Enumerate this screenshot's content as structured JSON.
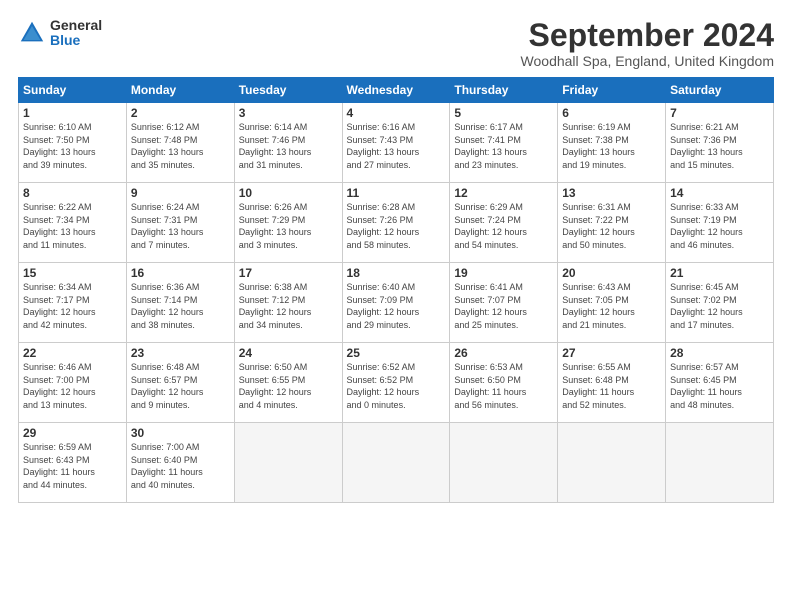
{
  "logo": {
    "general": "General",
    "blue": "Blue"
  },
  "title": "September 2024",
  "subtitle": "Woodhall Spa, England, United Kingdom",
  "headers": [
    "Sunday",
    "Monday",
    "Tuesday",
    "Wednesday",
    "Thursday",
    "Friday",
    "Saturday"
  ],
  "days": [
    {
      "num": "",
      "info": ""
    },
    {
      "num": "",
      "info": ""
    },
    {
      "num": "",
      "info": ""
    },
    {
      "num": "",
      "info": ""
    },
    {
      "num": "",
      "info": ""
    },
    {
      "num": "",
      "info": ""
    },
    {
      "num": "1",
      "info": "Sunrise: 6:10 AM\nSunset: 7:50 PM\nDaylight: 13 hours\nand 39 minutes."
    },
    {
      "num": "2",
      "info": "Sunrise: 6:12 AM\nSunset: 7:48 PM\nDaylight: 13 hours\nand 35 minutes."
    },
    {
      "num": "3",
      "info": "Sunrise: 6:14 AM\nSunset: 7:46 PM\nDaylight: 13 hours\nand 31 minutes."
    },
    {
      "num": "4",
      "info": "Sunrise: 6:16 AM\nSunset: 7:43 PM\nDaylight: 13 hours\nand 27 minutes."
    },
    {
      "num": "5",
      "info": "Sunrise: 6:17 AM\nSunset: 7:41 PM\nDaylight: 13 hours\nand 23 minutes."
    },
    {
      "num": "6",
      "info": "Sunrise: 6:19 AM\nSunset: 7:38 PM\nDaylight: 13 hours\nand 19 minutes."
    },
    {
      "num": "7",
      "info": "Sunrise: 6:21 AM\nSunset: 7:36 PM\nDaylight: 13 hours\nand 15 minutes."
    },
    {
      "num": "8",
      "info": "Sunrise: 6:22 AM\nSunset: 7:34 PM\nDaylight: 13 hours\nand 11 minutes."
    },
    {
      "num": "9",
      "info": "Sunrise: 6:24 AM\nSunset: 7:31 PM\nDaylight: 13 hours\nand 7 minutes."
    },
    {
      "num": "10",
      "info": "Sunrise: 6:26 AM\nSunset: 7:29 PM\nDaylight: 13 hours\nand 3 minutes."
    },
    {
      "num": "11",
      "info": "Sunrise: 6:28 AM\nSunset: 7:26 PM\nDaylight: 12 hours\nand 58 minutes."
    },
    {
      "num": "12",
      "info": "Sunrise: 6:29 AM\nSunset: 7:24 PM\nDaylight: 12 hours\nand 54 minutes."
    },
    {
      "num": "13",
      "info": "Sunrise: 6:31 AM\nSunset: 7:22 PM\nDaylight: 12 hours\nand 50 minutes."
    },
    {
      "num": "14",
      "info": "Sunrise: 6:33 AM\nSunset: 7:19 PM\nDaylight: 12 hours\nand 46 minutes."
    },
    {
      "num": "15",
      "info": "Sunrise: 6:34 AM\nSunset: 7:17 PM\nDaylight: 12 hours\nand 42 minutes."
    },
    {
      "num": "16",
      "info": "Sunrise: 6:36 AM\nSunset: 7:14 PM\nDaylight: 12 hours\nand 38 minutes."
    },
    {
      "num": "17",
      "info": "Sunrise: 6:38 AM\nSunset: 7:12 PM\nDaylight: 12 hours\nand 34 minutes."
    },
    {
      "num": "18",
      "info": "Sunrise: 6:40 AM\nSunset: 7:09 PM\nDaylight: 12 hours\nand 29 minutes."
    },
    {
      "num": "19",
      "info": "Sunrise: 6:41 AM\nSunset: 7:07 PM\nDaylight: 12 hours\nand 25 minutes."
    },
    {
      "num": "20",
      "info": "Sunrise: 6:43 AM\nSunset: 7:05 PM\nDaylight: 12 hours\nand 21 minutes."
    },
    {
      "num": "21",
      "info": "Sunrise: 6:45 AM\nSunset: 7:02 PM\nDaylight: 12 hours\nand 17 minutes."
    },
    {
      "num": "22",
      "info": "Sunrise: 6:46 AM\nSunset: 7:00 PM\nDaylight: 12 hours\nand 13 minutes."
    },
    {
      "num": "23",
      "info": "Sunrise: 6:48 AM\nSunset: 6:57 PM\nDaylight: 12 hours\nand 9 minutes."
    },
    {
      "num": "24",
      "info": "Sunrise: 6:50 AM\nSunset: 6:55 PM\nDaylight: 12 hours\nand 4 minutes."
    },
    {
      "num": "25",
      "info": "Sunrise: 6:52 AM\nSunset: 6:52 PM\nDaylight: 12 hours\nand 0 minutes."
    },
    {
      "num": "26",
      "info": "Sunrise: 6:53 AM\nSunset: 6:50 PM\nDaylight: 11 hours\nand 56 minutes."
    },
    {
      "num": "27",
      "info": "Sunrise: 6:55 AM\nSunset: 6:48 PM\nDaylight: 11 hours\nand 52 minutes."
    },
    {
      "num": "28",
      "info": "Sunrise: 6:57 AM\nSunset: 6:45 PM\nDaylight: 11 hours\nand 48 minutes."
    },
    {
      "num": "29",
      "info": "Sunrise: 6:59 AM\nSunset: 6:43 PM\nDaylight: 11 hours\nand 44 minutes."
    },
    {
      "num": "30",
      "info": "Sunrise: 7:00 AM\nSunset: 6:40 PM\nDaylight: 11 hours\nand 40 minutes."
    },
    {
      "num": "",
      "info": ""
    },
    {
      "num": "",
      "info": ""
    },
    {
      "num": "",
      "info": ""
    },
    {
      "num": "",
      "info": ""
    },
    {
      "num": "",
      "info": ""
    }
  ]
}
